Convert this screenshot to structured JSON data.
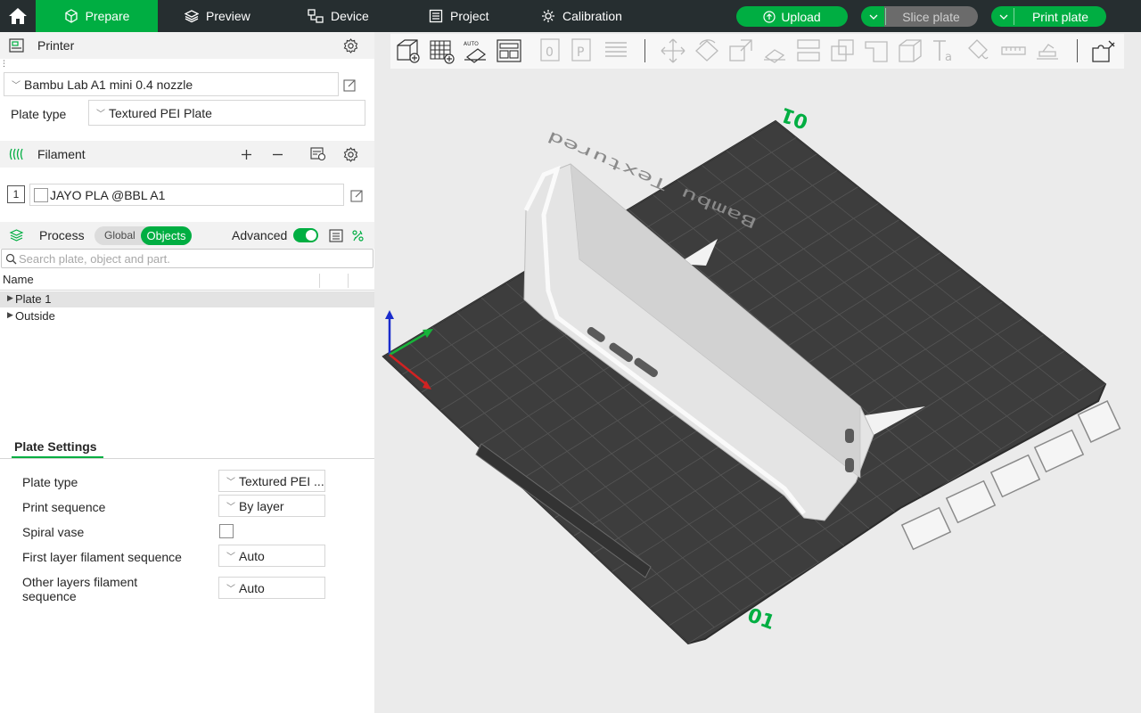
{
  "topbar": {
    "tabs": [
      {
        "label": "Prepare"
      },
      {
        "label": "Preview"
      },
      {
        "label": "Device"
      },
      {
        "label": "Project"
      },
      {
        "label": "Calibration"
      }
    ],
    "upload_label": "Upload",
    "slice_label": "Slice plate",
    "print_label": "Print plate"
  },
  "printer": {
    "title": "Printer",
    "preset": "Bambu Lab A1 mini 0.4 nozzle",
    "plate_type_label": "Plate type",
    "plate_type_value": "Textured PEI Plate"
  },
  "filament": {
    "title": "Filament",
    "slot_number": "1",
    "name": "JAYO PLA @BBL A1"
  },
  "process": {
    "title": "Process",
    "toggle_global": "Global",
    "toggle_objects": "Objects",
    "advanced_label": "Advanced",
    "search_placeholder": "Search plate, object and part."
  },
  "object_list": {
    "column_name": "Name",
    "rows": [
      {
        "label": "Plate 1"
      },
      {
        "label": "Outside"
      }
    ]
  },
  "plate_settings": {
    "tab_label": "Plate Settings",
    "rows": [
      {
        "label": "Plate type",
        "value": "Textured PEI ..."
      },
      {
        "label": "Print sequence",
        "value": "By layer"
      },
      {
        "label": "Spiral vase",
        "value": ""
      },
      {
        "label": "First layer filament sequence",
        "value": "Auto"
      },
      {
        "label": "Other layers filament sequence",
        "value": "Auto"
      }
    ]
  },
  "viewport": {
    "bed_brand_text": "Bambu Textured",
    "plate_number_top": "01",
    "plate_number_bottom": "01"
  },
  "colors": {
    "accent": "#00ae42",
    "topbar": "#262e30",
    "bed": "#3d3d3d"
  }
}
